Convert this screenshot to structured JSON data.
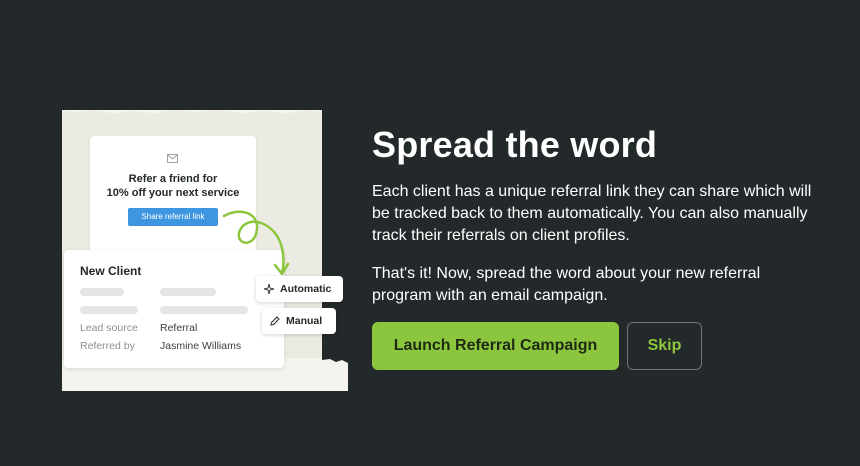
{
  "illustration": {
    "referral_card": {
      "icon": "mail-icon",
      "line1": "Refer a friend for",
      "line2": "10% off your next service",
      "share_button": "Share referral link",
      "button_color": "#3e95e0"
    },
    "client_card": {
      "title": "New Client",
      "fields": [
        {
          "label": "Lead source",
          "value": "Referral"
        },
        {
          "label": "Referred by",
          "value": "Jasmine Williams"
        }
      ]
    },
    "chips": {
      "automatic": {
        "icon": "sparkle-icon",
        "label": "Automatic"
      },
      "manual": {
        "icon": "pencil-icon",
        "label": "Manual"
      }
    },
    "arrow_color": "#8cc63f"
  },
  "content": {
    "title": "Spread the word",
    "paragraph1": "Each client has a unique referral link they can share which will be tracked back to them automatically. You can also manually track their referrals on client profiles.",
    "paragraph2": "That's it! Now, spread the word about your new referral program with an email campaign."
  },
  "actions": {
    "primary_label": "Launch Referral Campaign",
    "secondary_label": "Skip"
  },
  "colors": {
    "background": "#23282a",
    "accent": "#8cc63f",
    "paper": "#ecebe3"
  }
}
